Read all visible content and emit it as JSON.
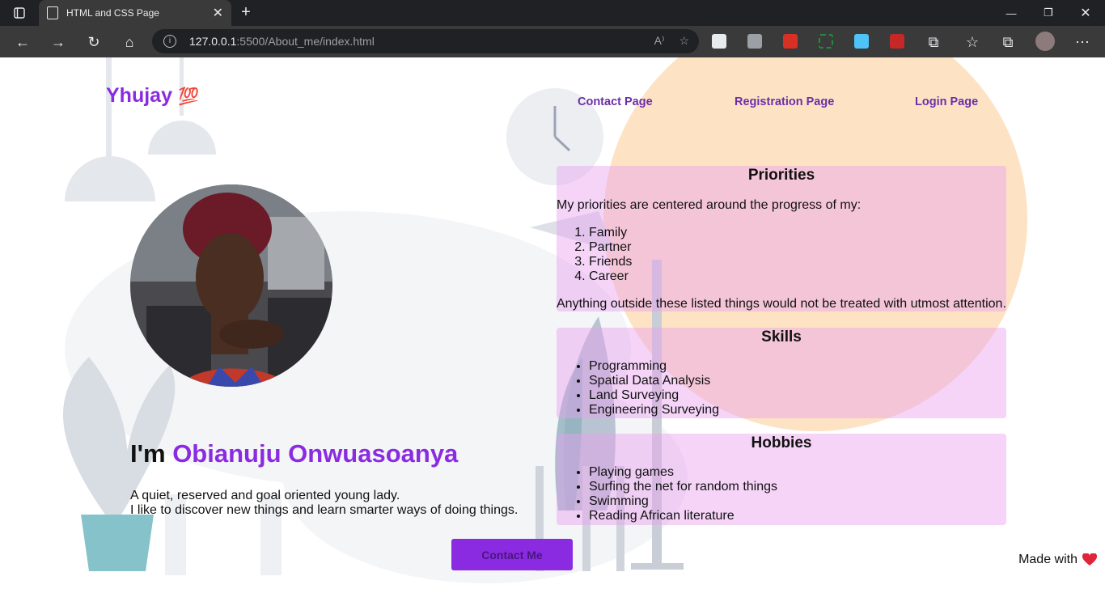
{
  "browser": {
    "tab_title": "HTML and CSS Page",
    "url_host": "127.0.0.1",
    "url_path": ":5500/About_me/index.html"
  },
  "site": {
    "logo_text": "Yhujay",
    "logo_emoji": "💯",
    "nav": [
      "Contact Page",
      "Registration Page",
      "Login Page"
    ]
  },
  "hero": {
    "greeting": "I'm",
    "name": "Obianuju Onwuasoanya",
    "line1": "A quiet, reserved and goal oriented young lady.",
    "line2": "I like to discover new things and learn smarter ways of doing things.",
    "button": "Contact Me"
  },
  "priorities": {
    "heading": "Priorities",
    "intro": "My priorities are centered around the progress of my:",
    "items": [
      "Family",
      "Partner",
      "Friends",
      "Career"
    ],
    "outro": "Anything outside these listed things would not be treated with utmost attention."
  },
  "skills": {
    "heading": "Skills",
    "items": [
      "Programming",
      "Spatial Data Analysis",
      "Land Surveying",
      "Engineering Surveying"
    ]
  },
  "hobbies": {
    "heading": "Hobbies",
    "items": [
      "Playing games",
      "Surfing the net for random things",
      "Swimming",
      "Reading African literature"
    ]
  },
  "footer": {
    "made_with": "Made with"
  },
  "colors": {
    "accent": "#8a2be2",
    "nav_link": "#6b2fa8",
    "circle": "#fde3c4",
    "card": "#e8a0f0"
  }
}
